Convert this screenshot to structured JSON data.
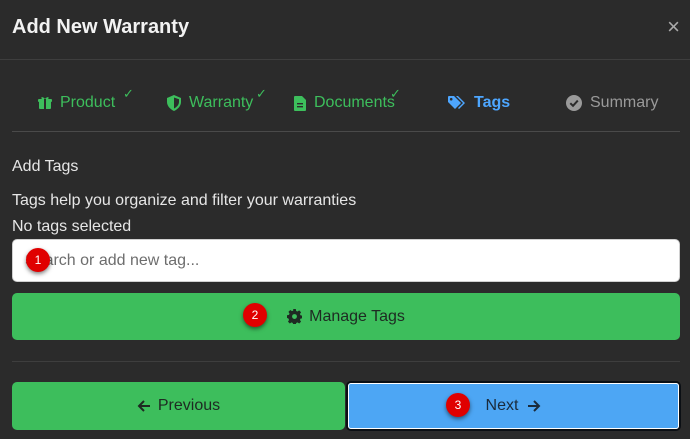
{
  "modal": {
    "title": "Add New Warranty",
    "close_glyph": "×"
  },
  "steps": [
    {
      "label": "Product",
      "icon": "gift-icon",
      "state": "done",
      "check": "✓"
    },
    {
      "label": "Warranty",
      "icon": "shield-icon",
      "state": "done",
      "check": "✓"
    },
    {
      "label": "Documents",
      "icon": "document-icon",
      "state": "done",
      "check": "✓"
    },
    {
      "label": "Tags",
      "icon": "tags-icon",
      "state": "active"
    },
    {
      "label": "Summary",
      "icon": "check-circle-icon",
      "state": "pending"
    }
  ],
  "tags": {
    "heading": "Add Tags",
    "help": "Tags help you organize and filter your warranties",
    "selected": "No tags selected",
    "search_placeholder": "Search or add new tag...",
    "manage_label": "Manage Tags"
  },
  "footer": {
    "previous_label": "Previous",
    "next_label": "Next"
  },
  "badges": [
    "1",
    "2",
    "3"
  ],
  "colors": {
    "success": "#3dbe5c",
    "primary": "#4da6f4",
    "active_step": "#4da6ff",
    "background": "#2b2b2b",
    "badge": "#e00000"
  }
}
